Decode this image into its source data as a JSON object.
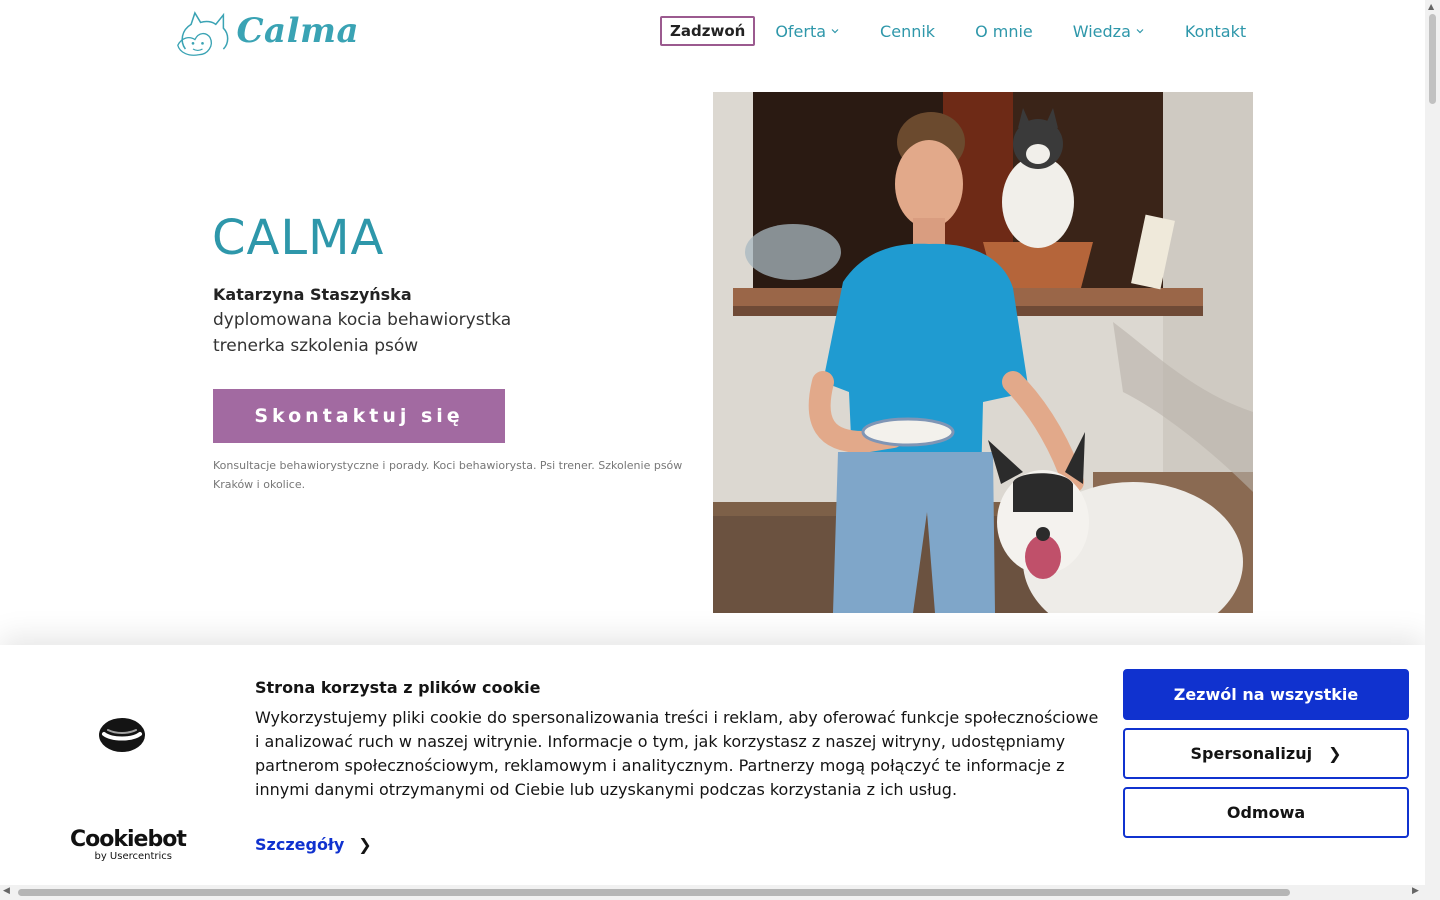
{
  "header": {
    "logo_text": "Calma",
    "nav": {
      "call": "Zadzwoń",
      "items": [
        {
          "label": "Oferta",
          "has_dropdown": true
        },
        {
          "label": "Cennik",
          "has_dropdown": false
        },
        {
          "label": "O mnie",
          "has_dropdown": false
        },
        {
          "label": "Wiedza",
          "has_dropdown": true
        },
        {
          "label": "Kontakt",
          "has_dropdown": false
        }
      ]
    }
  },
  "hero": {
    "title": "CALMA",
    "name": "Katarzyna Staszyńska",
    "line1": "dyplomowana kocia behawiorystka",
    "line2": "trenerka szkolenia psów",
    "cta": "Skontaktuj się",
    "note": "Konsultacje behawiorystyczne i porady. Koci behawiorysta. Psi trener. Szkolenie psów Kraków i okolice."
  },
  "cookie_banner": {
    "brand": "Cookiebot",
    "brand_sub": "by Usercentrics",
    "title": "Strona korzysta z plików cookie",
    "text": "Wykorzystujemy pliki cookie do spersonalizowania treści i reklam, aby oferować funkcje społecznościowe i analizować ruch w naszej witrynie. Informacje o tym, jak korzystasz z naszej witryny, udostępniamy partnerom społecznościowym, reklamowym i analitycznym. Partnerzy mogą połączyć te informacje z innymi danymi otrzymanymi od Ciebie lub uzyskanymi podczas korzystania z ich usług.",
    "details": "Szczegóły",
    "allow_all": "Zezwól na wszystkie",
    "customize": "Spersonalizuj",
    "deny": "Odmowa"
  },
  "colors": {
    "teal": "#2e97aa",
    "cta_purple": "#a26aa1",
    "call_border": "#9b5a8f",
    "cookie_blue": "#1032cf"
  }
}
